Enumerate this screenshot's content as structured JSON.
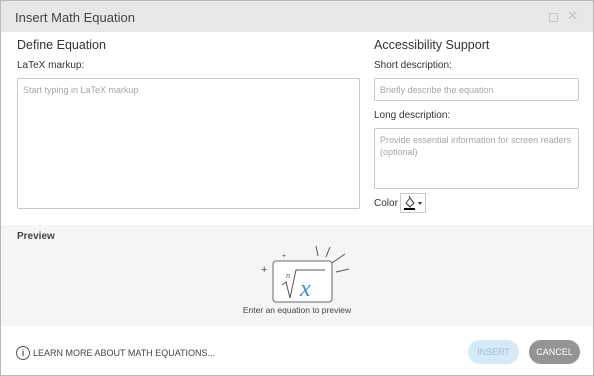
{
  "dialog": {
    "title": "Insert Math Equation"
  },
  "define": {
    "heading": "Define Equation",
    "latex_label": "LaTeX markup:",
    "latex_placeholder": "Start typing in LaTeX markup"
  },
  "accessibility": {
    "heading": "Accessibility Support",
    "short_label": "Short description:",
    "short_placeholder": "Briefly describe the equation",
    "long_label": "Long description:",
    "long_placeholder": "Provide essential information for screen readers (optional)",
    "color_label": "Color"
  },
  "preview": {
    "label": "Preview",
    "message": "Enter an equation to preview",
    "art_index": "n",
    "art_variable": "x",
    "art_plus": "+"
  },
  "footer": {
    "learn_more": "LEARN MORE ABOUT MATH EQUATIONS...",
    "insert_label": "INSERT",
    "cancel_label": "CANCEL"
  },
  "colors": {
    "accent": "#3d8ec9",
    "insert_bg": "#d6e9f6",
    "cancel_bg": "#929496"
  },
  "icons": {
    "maximize": "maximize-icon",
    "close": "close-icon",
    "color_picker": "paint-bucket-icon",
    "dropdown": "caret-down-icon",
    "info": "info-icon"
  }
}
